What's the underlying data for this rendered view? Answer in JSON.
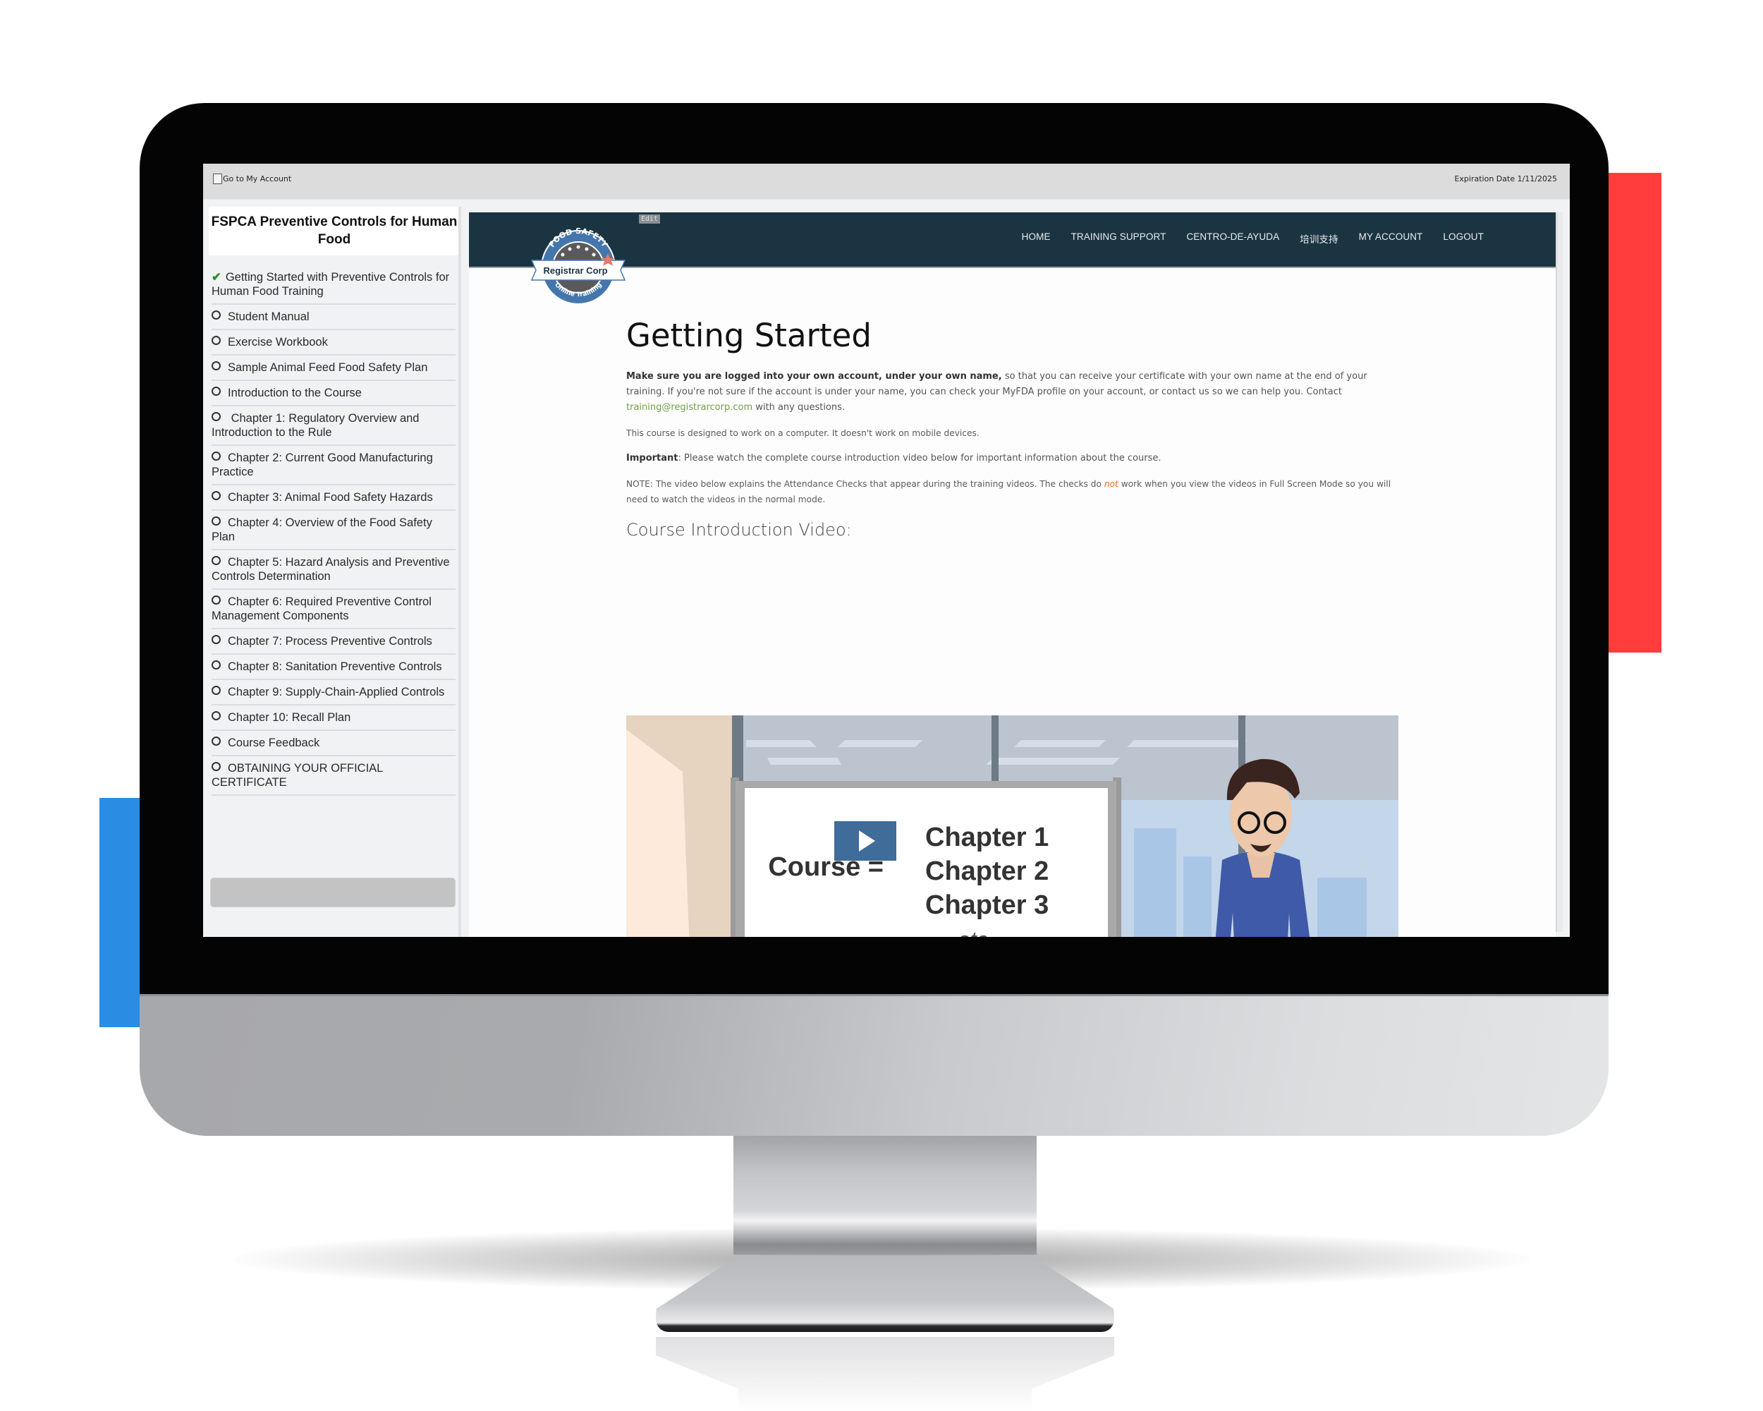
{
  "topbar": {
    "go_to_account": "Go to My Account",
    "expiration": "Expiration Date 1/11/2025"
  },
  "sidebar": {
    "course_title": "FSPCA Preventive Controls for Human Food",
    "items": [
      {
        "label": "Getting Started with Preventive Controls for Human Food Training",
        "status": "completed",
        "icon": "check-icon"
      },
      {
        "label": "Student Manual",
        "status": "incomplete",
        "icon": "circle-icon"
      },
      {
        "label": "Exercise Workbook",
        "status": "incomplete",
        "icon": "circle-icon"
      },
      {
        "label": "Sample Animal Feed Food Safety Plan",
        "status": "incomplete",
        "icon": "circle-icon"
      },
      {
        "label": "Introduction to the Course",
        "status": "incomplete",
        "icon": "circle-icon"
      },
      {
        "label": " Chapter 1: Regulatory Overview and Introduction to the Rule",
        "status": "incomplete",
        "icon": "circle-icon"
      },
      {
        "label": "Chapter 2: Current Good Manufacturing Practice",
        "status": "incomplete",
        "icon": "circle-icon"
      },
      {
        "label": "Chapter 3: Animal Food Safety Hazards",
        "status": "incomplete",
        "icon": "circle-icon"
      },
      {
        "label": "Chapter 4: Overview of the Food Safety Plan",
        "status": "incomplete",
        "icon": "circle-icon"
      },
      {
        "label": "Chapter 5: Hazard Analysis and Preventive Controls Determination",
        "status": "incomplete",
        "icon": "circle-icon"
      },
      {
        "label": "Chapter 6: Required Preventive Control Management Components",
        "status": "incomplete",
        "icon": "circle-icon"
      },
      {
        "label": "Chapter 7: Process Preventive Controls",
        "status": "incomplete",
        "icon": "circle-icon"
      },
      {
        "label": "Chapter 8: Sanitation Preventive Controls",
        "status": "incomplete",
        "icon": "circle-icon"
      },
      {
        "label": "Chapter 9: Supply-Chain-Applied Controls",
        "status": "incomplete",
        "icon": "circle-icon"
      },
      {
        "label": "Chapter 10: Recall Plan",
        "status": "incomplete",
        "icon": "circle-icon"
      },
      {
        "label": "Course Feedback",
        "status": "incomplete",
        "icon": "circle-icon"
      },
      {
        "label": "OBTAINING YOUR OFFICIAL CERTIFICATE",
        "status": "incomplete",
        "icon": "circle-icon"
      }
    ]
  },
  "header": {
    "edit_label": "Edit",
    "logo": {
      "top_text": "FOOD SAFETY",
      "band_text": "Registrar Corp",
      "bottom_text": "Online Training"
    },
    "nav": [
      "HOME",
      "TRAINING SUPPORT",
      "CENTRO-DE-AYUDA",
      "培训支持",
      "MY ACCOUNT",
      "LOGOUT"
    ]
  },
  "content": {
    "title": "Getting Started",
    "p1_bold": "Make sure you are logged into your own account, under your own name,",
    "p1_rest": " so that you can receive your certificate with your own name at the end of your training. If you're not sure if the account is under your name, you can check your MyFDA profile on your account, or contact us so we can help you. Contact ",
    "p1_email": "training@registrarcorp.com",
    "p1_end": " with any questions.",
    "p2": "This course is designed to work on a computer. It doesn't work on mobile devices.",
    "p3_bold": "Important",
    "p3_rest": ": Please watch the complete course introduction video below for important information about the course.",
    "p4_start": "NOTE: The video below explains the Attendance Checks that appear during the training videos. The checks do ",
    "p4_em": "not",
    "p4_end": " work when you view the videos in Full Screen Mode so you will need to watch the videos in the normal mode.",
    "video_heading": "Course Introduction Video:"
  },
  "video": {
    "board_left": "Course =",
    "board_lines": [
      "Chapter 1",
      "Chapter 2",
      "Chapter 3",
      "etc."
    ],
    "play_icon": "play-icon"
  },
  "colors": {
    "header_bg": "#1b3441",
    "accent_red": "#ff3d3d",
    "accent_blue": "#2a8ce2",
    "link_green": "#6ea046",
    "emphasis_orange": "#ef6a1c",
    "check_green": "#2e8b2e",
    "play_button": "#2f5f8f"
  }
}
